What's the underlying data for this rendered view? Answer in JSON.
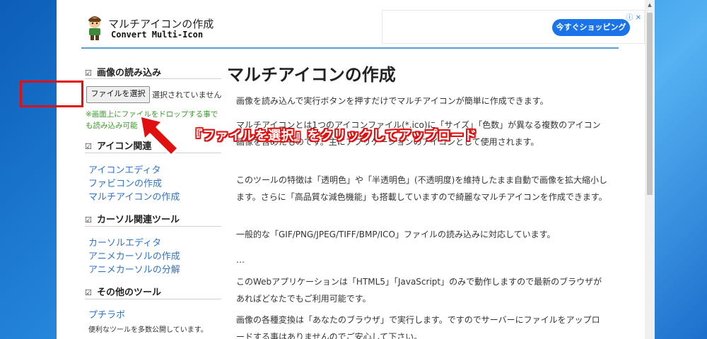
{
  "header": {
    "title": "マルチアイコンの作成",
    "subtitle": "Convert Multi-Icon",
    "ad_button": "今すぐショッピング",
    "ad_info": "ⓘ ✕"
  },
  "sidebar": {
    "image_section": {
      "heading": "画像の読み込み",
      "file_button": "ファイルを選択",
      "file_status": "選択されていません",
      "drop_note": "※画面上にファイルをドロップする事でも読み込み可能"
    },
    "icon_section": {
      "heading": "アイコン関連",
      "links": [
        "アイコンエディタ",
        "ファビコンの作成",
        "マルチアイコンの作成"
      ]
    },
    "cursor_section": {
      "heading": "カーソル関連ツール",
      "links": [
        "カーソルエディタ",
        "アニメカーソルの作成",
        "アニメカーソルの分解"
      ]
    },
    "other_section": {
      "heading": "その他のツール",
      "link": "プチラボ",
      "note": "便利なツールを多数公開しています。"
    }
  },
  "main": {
    "title": "マルチアイコンの作成",
    "paragraphs": [
      "画像を読み込んで実行ボタンを押すだけでマルチアイコンが簡単に作成できます。",
      "マルチアイコンとは1つのアイコンファイル(*.ico)に「サイズ」「色数」が異なる複数のアイコン画像を含めたものです。主にアプリケーションのアイコンとして使用されます。",
      "このツールの特徴は「透明色」や「半透明色」(不透明度)を維持したまま自動で画像を拡大縮小します。さらに「高品質な減色機能」も搭載していますので綺麗なマルチアイコンを作成できます。",
      "一般的な「GIF/PNG/JPEG/TIFF/BMP/ICO」ファイルの読み込みに対応しています。",
      "…",
      "このWebアプリケーションは「HTML5」「JavaScript」のみで動作しますので最新のブラウザがあればどなたでもご利用可能です。",
      "画像の各種変換は「あなたのブラウザ」で実行します。ですのでサーバーにファイルをアップロードする事はありませんのでご安心して下さい。"
    ]
  },
  "annotation": {
    "callout": "『ファイルを選択』をクリックしてアップロード",
    "color": "#e01010"
  }
}
